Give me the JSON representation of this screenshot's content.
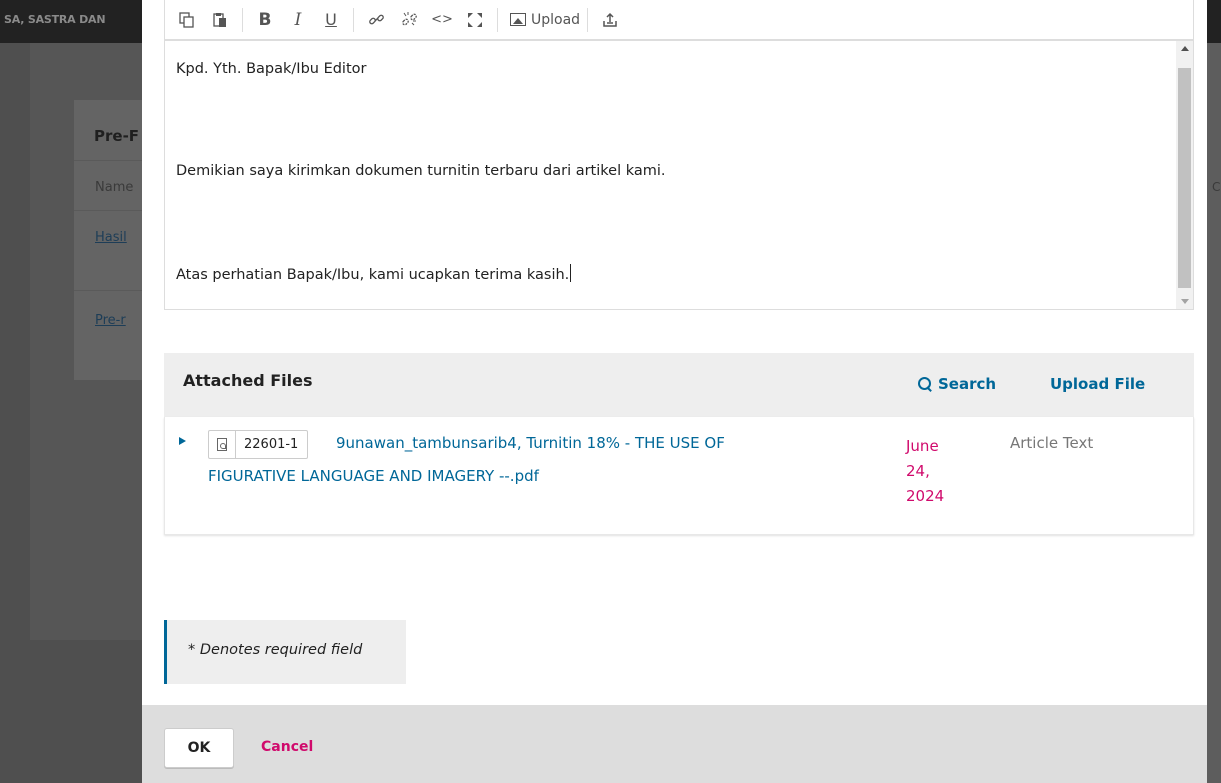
{
  "background": {
    "topbar_text": "SA, SASTRA DAN",
    "right_topbar_text": "",
    "card_title": "Pre-F",
    "column_name": "Name",
    "link1": "Hasil",
    "link2": "Pre-r",
    "right_mark": "C"
  },
  "toolbar": {
    "upload_label": "Upload"
  },
  "editor": {
    "line1": "Kpd. Yth. Bapak/Ibu Editor",
    "line2": "Demikian saya kirimkan dokumen turnitin terbaru dari artikel kami.",
    "line3": "Atas perhatian Bapak/Ibu, kami ucapkan terima kasih."
  },
  "attached_files": {
    "title": "Attached Files",
    "search_label": "Search",
    "upload_label": "Upload File",
    "files": [
      {
        "id": "22601-1",
        "name_part1": "9unawan_tambunsarib4, Turnitin 18% - THE USE OF",
        "name_part2": "FIGURATIVE LANGUAGE AND IMAGERY --.pdf",
        "date_month": "June",
        "date_day": "24,",
        "date_year": "2024",
        "type": "Article Text"
      }
    ]
  },
  "required_note": "* Denotes required field",
  "footer": {
    "ok_label": "OK",
    "cancel_label": "Cancel"
  },
  "colors": {
    "link_blue": "#006798",
    "accent_pink": "#d00a6c",
    "overlay": "#4f4f4f"
  }
}
